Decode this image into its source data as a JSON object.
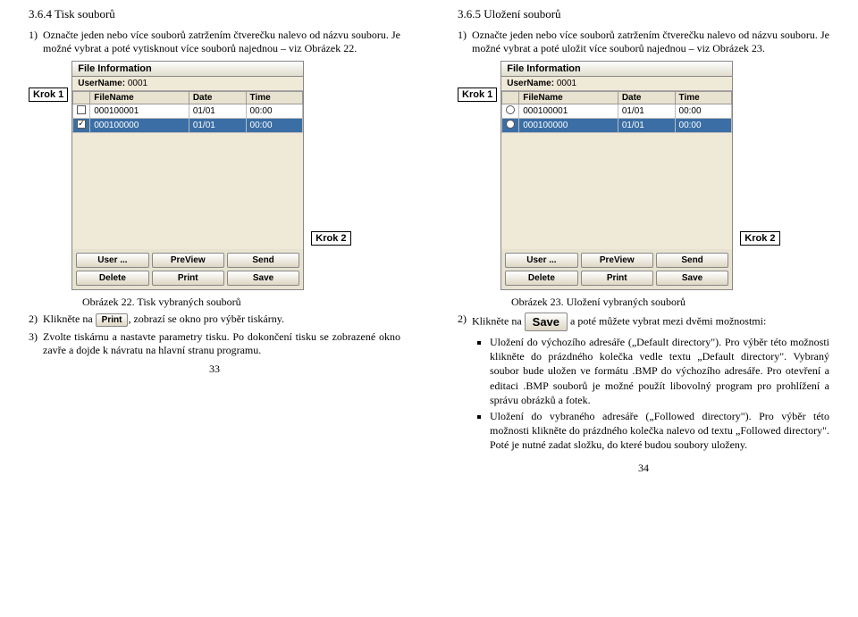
{
  "left": {
    "section_title": "3.6.4 Tisk souborů",
    "step1_num": "1)",
    "step1_text": "Označte jeden nebo více souborů zatržením čtverečku nalevo od názvu souboru. Je možné vybrat a poté vytisknout více souborů najednou – viz Obrázek 22.",
    "krok1": "Krok 1",
    "krok2": "Krok 2",
    "app": {
      "title": "File Information",
      "user_label": "UserName:",
      "user_value": "0001",
      "cols": {
        "c1": "FileName",
        "c2": "Date",
        "c3": "Time"
      },
      "rows": [
        {
          "checked": false,
          "name": "000100001",
          "date": "01/01",
          "time": "00:00",
          "sel": false
        },
        {
          "checked": true,
          "name": "000100000",
          "date": "01/01",
          "time": "00:00",
          "sel": true
        }
      ],
      "btns": {
        "b1": "User ...",
        "b2": "PreView",
        "b3": "Send",
        "b4": "Delete",
        "b5": "Print",
        "b6": "Save"
      }
    },
    "caption": "Obrázek 22. Tisk vybraných souborů",
    "step2_num": "2)",
    "step2_a": "Klikněte na ",
    "step2_btn": "Print",
    "step2_b": ", zobrazí se okno pro výběr tiskárny.",
    "step3_num": "3)",
    "step3_text": "Zvolte tiskárnu a nastavte parametry tisku. Po dokončení tisku se zobrazené okno zavře a dojde k návratu na hlavní stranu programu.",
    "page_num": "33"
  },
  "right": {
    "section_title": "3.6.5 Uložení souborů",
    "step1_num": "1)",
    "step1_text": "Označte jeden nebo více souborů zatržením čtverečku nalevo od názvu souboru. Je možné vybrat a poté uložit více souborů najednou – viz Obrázek 23.",
    "krok1": "Krok 1",
    "krok2": "Krok 2",
    "app": {
      "title": "File Information",
      "user_label": "UserName:",
      "user_value": "0001",
      "cols": {
        "c1": "FileName",
        "c2": "Date",
        "c3": "Time"
      },
      "rows": [
        {
          "name": "000100001",
          "date": "01/01",
          "time": "00:00",
          "sel": false
        },
        {
          "name": "000100000",
          "date": "01/01",
          "time": "00:00",
          "sel": true
        }
      ],
      "btns": {
        "b1": "User ...",
        "b2": "PreView",
        "b3": "Send",
        "b4": "Delete",
        "b5": "Print",
        "b6": "Save"
      }
    },
    "caption": "Obrázek 23. Uložení vybraných souborů",
    "step2_num": "2)",
    "step2_a": "Klikněte na ",
    "step2_btn": "Save",
    "step2_b": " a poté můžete vybrat mezi dvěmi možnostmi:",
    "bullet1": "Uložení do výchozího adresáře („Default directory\"). Pro výběr této možnosti klikněte do prázdného kolečka vedle textu „Default directory\". Vybraný soubor bude uložen ve formátu .BMP do výchozího adresáře. Pro otevření a editaci .BMP souborů je možné použít libovolný program pro prohlížení a správu obrázků a fotek.",
    "bullet2": "Uložení do vybraného adresáře („Followed directory\"). Pro výběr této možnosti klikněte do prázdného kolečka nalevo od textu „Followed directory\". Poté je nutné zadat složku, do které budou soubory uloženy.",
    "page_num": "34"
  }
}
